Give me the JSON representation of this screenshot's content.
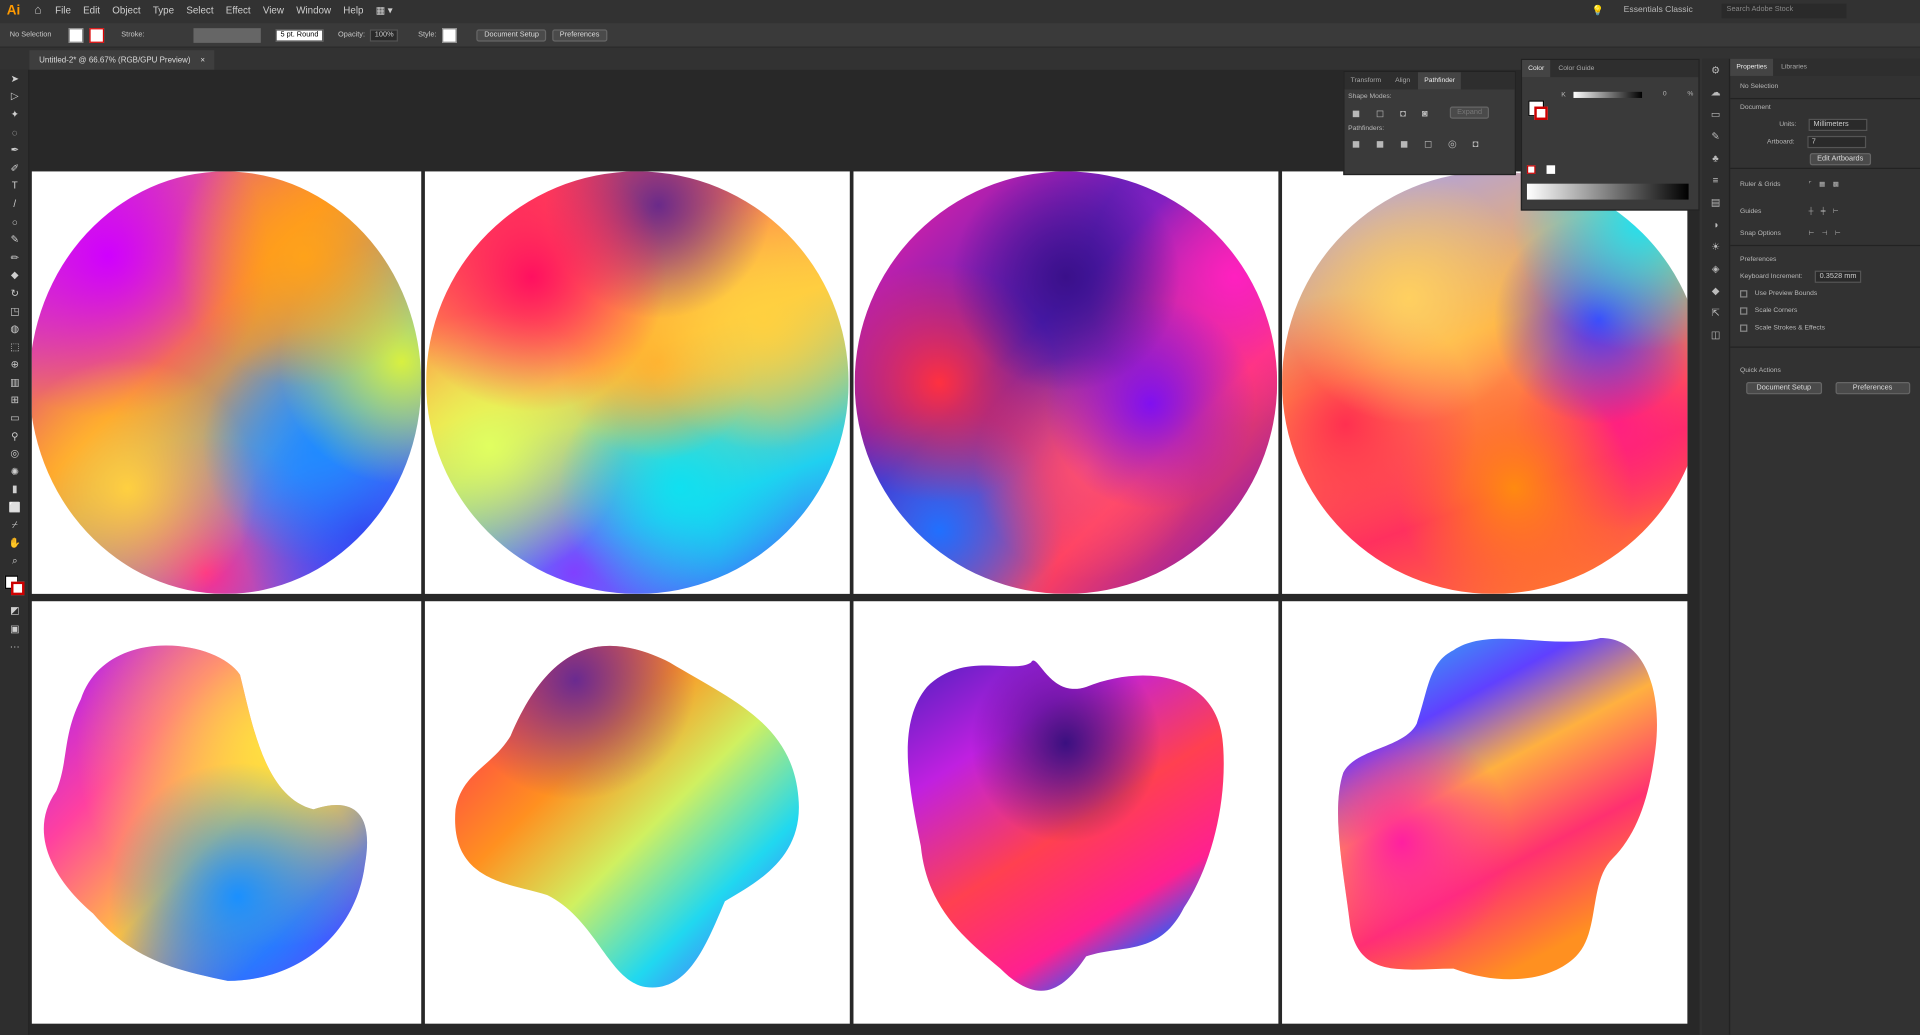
{
  "menubar": {
    "logo": "Ai",
    "items": [
      "File",
      "Edit",
      "Object",
      "Type",
      "Select",
      "Effect",
      "View",
      "Window",
      "Help"
    ],
    "workspace": "Essentials Classic",
    "search_placeholder": "Search Adobe Stock"
  },
  "control": {
    "selection": "No Selection",
    "stroke_label": "Stroke:",
    "brush": "5 pt. Round",
    "opacity_label": "Opacity:",
    "opacity": "100%",
    "style_label": "Style:",
    "doc_setup": "Document Setup",
    "prefs": "Preferences"
  },
  "doc": {
    "tab": "Untitled-2* @ 66.67% (RGB/GPU Preview)"
  },
  "pathfinder": {
    "tabs": [
      "Transform",
      "Align",
      "Pathfinder"
    ],
    "shape_modes": "Shape Modes:",
    "expand": "Expand",
    "pathfinders": "Pathfinders:"
  },
  "color": {
    "tabs": [
      "Color",
      "Color Guide"
    ],
    "channel": "K",
    "value": "0",
    "unit": "%"
  },
  "properties": {
    "tabs": [
      "Properties",
      "Libraries"
    ],
    "selection": "No Selection",
    "document": "Document",
    "units_label": "Units:",
    "units": "Millimeters",
    "artboard_label": "Artboard:",
    "artboard": "7",
    "edit_artboards": "Edit Artboards",
    "rulers": "Ruler & Grids",
    "guides": "Guides",
    "snap": "Snap Options",
    "preferences": "Preferences",
    "keyboard_label": "Keyboard Increment:",
    "keyboard": "0.3528 mm",
    "opt1": "Use Preview Bounds",
    "opt2": "Scale Corners",
    "opt3": "Scale Strokes & Effects",
    "quick": "Quick Actions",
    "doc_setup": "Document Setup",
    "prefs": "Preferences"
  },
  "colors": {
    "accent": "#ff9a00"
  }
}
